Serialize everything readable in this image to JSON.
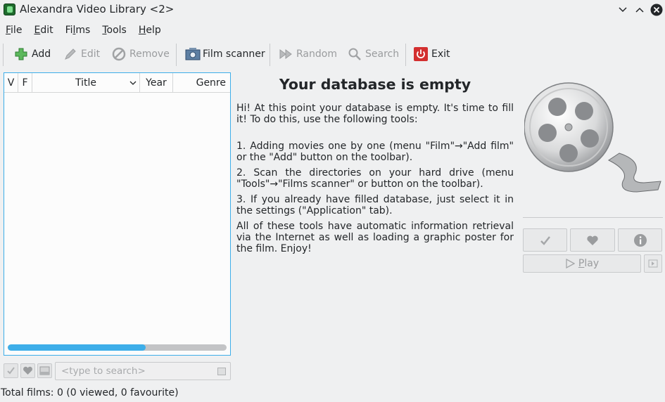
{
  "window": {
    "title": "Alexandra Video Library <2>"
  },
  "menubar": [
    {
      "pre": "",
      "u": "F",
      "post": "ile"
    },
    {
      "pre": "",
      "u": "E",
      "post": "dit"
    },
    {
      "pre": "Fi",
      "u": "l",
      "post": "ms"
    },
    {
      "pre": "",
      "u": "T",
      "post": "ools"
    },
    {
      "pre": "",
      "u": "H",
      "post": "elp"
    }
  ],
  "toolbar": {
    "add": "Add",
    "edit": "Edit",
    "remove": "Remove",
    "film_scanner": "Film scanner",
    "random": "Random",
    "search": "Search",
    "exit": "Exit"
  },
  "films_table": {
    "columns": [
      "V",
      "F",
      "Title",
      "Year",
      "Genre"
    ],
    "rows": [],
    "progress_fraction": 0.63
  },
  "search": {
    "placeholder": "<type to search>"
  },
  "status": {
    "text": "Total films: 0 (0 viewed, 0 favourite)"
  },
  "info": {
    "heading": "Your database is empty",
    "intro": "Hi! At this point your database is empty. It's time to fill it! To do this, use the following tools:",
    "step1": "1. Adding movies one by one (menu \"Film\"→\"Add film\" or the \"Add\" button on the toolbar).",
    "step2": "2. Scan the directories on your hard drive (menu \"Tools\"→\"Films scanner\" or button on the toolbar).",
    "step3": "3. If you already have filled database, just select it in the settings (\"Application\" tab).",
    "outro": "All of these tools have automatic information retrieval via the Internet as well as loading a graphic poster for the film. Enjoy!"
  },
  "player": {
    "play_pre": "",
    "play_u": "P",
    "play_post": "lay"
  },
  "colors": {
    "accent": "#3daee9",
    "exit_red": "#d32f2f",
    "add_green": "#4caf50"
  }
}
